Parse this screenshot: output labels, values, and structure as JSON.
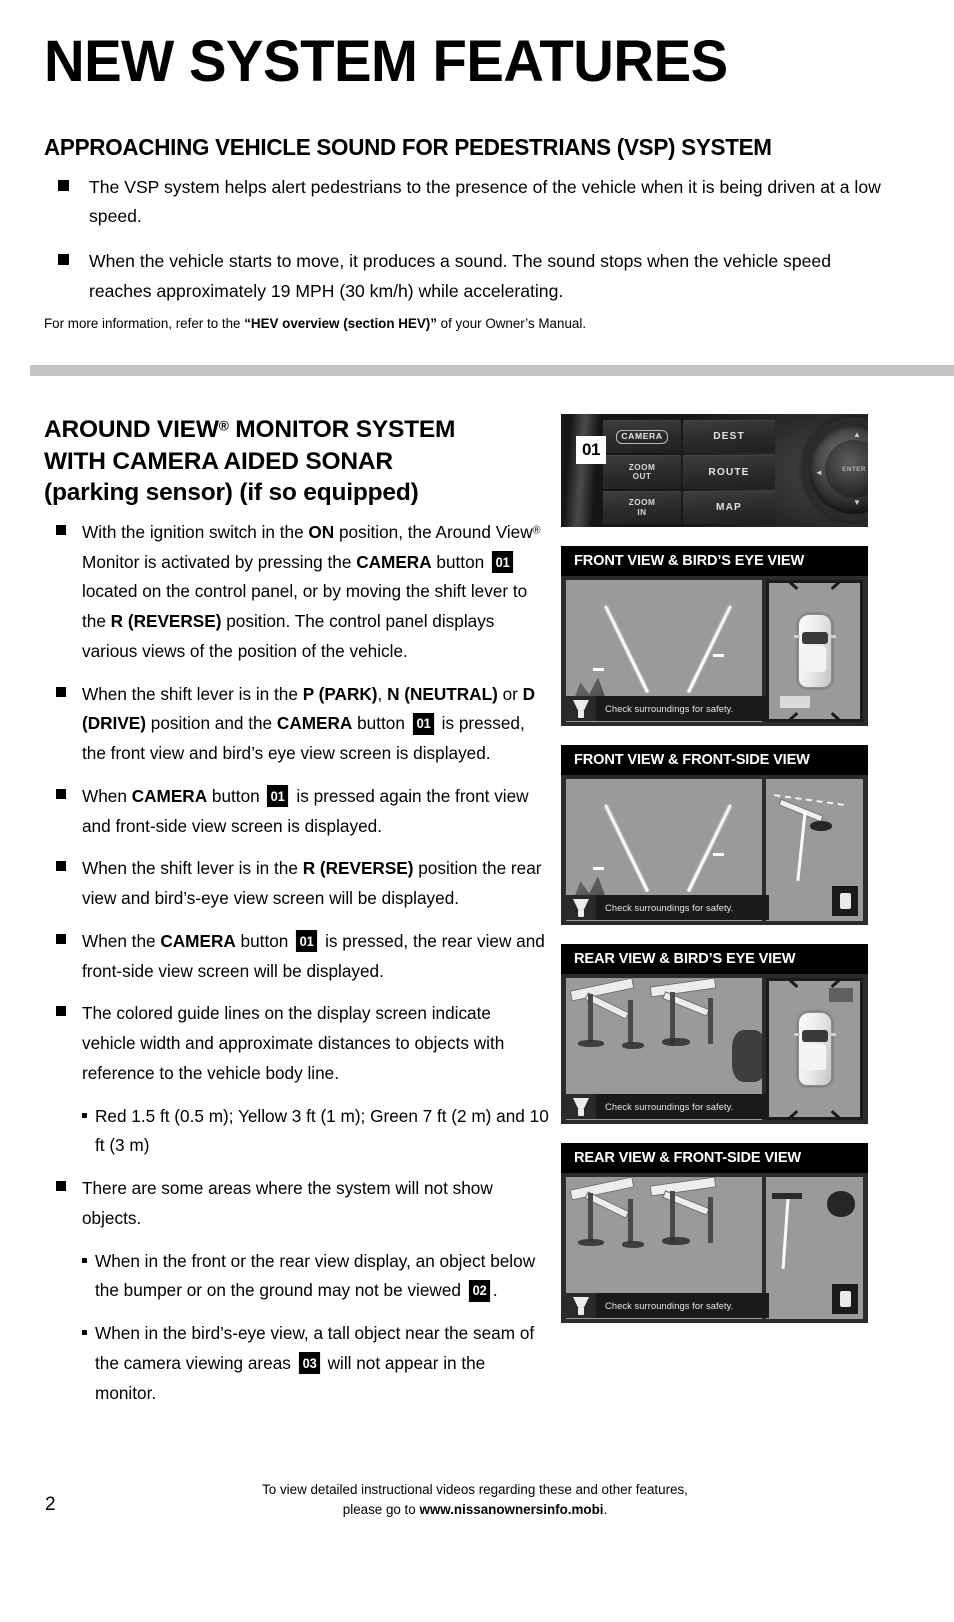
{
  "document": {
    "title": "NEW SYSTEM FEATURES",
    "page_number": "2"
  },
  "section_vsp": {
    "heading": "APPROACHING VEHICLE SOUND FOR PEDESTRIANS (VSP) SYSTEM",
    "bullets": [
      "The VSP system helps alert pedestrians to the presence of the vehicle when it is being driven at a low speed.",
      "When the vehicle starts to move, it produces a sound. The sound stops when the vehicle speed reaches approximately 19 MPH (30 km/h) while accelerating."
    ],
    "footnote_prefix": "For more information, refer to the ",
    "footnote_bold": "“HEV overview (section HEV)”",
    "footnote_suffix": " of your Owner’s Manual."
  },
  "section_avm": {
    "heading_line1": "AROUND VIEW",
    "heading_registered": "®",
    "heading_line1b": " MONITOR SYSTEM",
    "heading_line2": "WITH CAMERA AIDED SONAR",
    "heading_line3": "(parking sensor) (if so equipped)",
    "bullets": [
      {
        "id": "bullet-ignition-on",
        "parts": [
          {
            "t": "With the ignition switch in the "
          },
          {
            "t": "ON",
            "b": true
          },
          {
            "t": " position, the Around View"
          },
          {
            "t": "®",
            "sup": true
          },
          {
            "t": " Monitor is activated by pressing the "
          },
          {
            "t": "CAMERA",
            "b": true
          },
          {
            "t": " button "
          },
          {
            "t": "01",
            "callout": true
          },
          {
            "t": " located on the control panel, or by moving the shift lever to the "
          },
          {
            "t": "R (REVERSE)",
            "b": true
          },
          {
            "t": " position. The control panel displays various views of the position of the vehicle."
          }
        ]
      },
      {
        "id": "bullet-park-neutral-drive",
        "parts": [
          {
            "t": "When the shift lever is in the "
          },
          {
            "t": "P (PARK)",
            "b": true
          },
          {
            "t": ", "
          },
          {
            "t": "N (NEUTRAL)",
            "b": true
          },
          {
            "t": " or "
          },
          {
            "t": "D (DRIVE)",
            "b": true
          },
          {
            "t": " position and the "
          },
          {
            "t": "CAMERA",
            "b": true
          },
          {
            "t": " button "
          },
          {
            "t": "01",
            "callout": true
          },
          {
            "t": " is pressed, the front view and bird’s eye view screen is displayed."
          }
        ]
      },
      {
        "id": "bullet-camera-pressed-again",
        "parts": [
          {
            "t": "When "
          },
          {
            "t": "CAMERA",
            "b": true
          },
          {
            "t": " button "
          },
          {
            "t": "01",
            "callout": true
          },
          {
            "t": " is pressed again the front view and front-side view screen is displayed."
          }
        ]
      },
      {
        "id": "bullet-reverse-position",
        "parts": [
          {
            "t": "When the shift lever is in the "
          },
          {
            "t": "R (REVERSE)",
            "b": true
          },
          {
            "t": " position the rear view and bird’s-eye view screen will be displayed."
          }
        ]
      },
      {
        "id": "bullet-camera-rear-front-side",
        "parts": [
          {
            "t": "When the "
          },
          {
            "t": "CAMERA",
            "b": true
          },
          {
            "t": " button "
          },
          {
            "t": "01",
            "callout": true
          },
          {
            "t": " is pressed, the rear view and front-side view screen will be displayed."
          }
        ]
      },
      {
        "id": "bullet-guide-lines",
        "parts": [
          {
            "t": "The colored guide lines on the display screen indicate vehicle width and approximate distances to objects with reference to the vehicle body line."
          }
        ],
        "subs": [
          {
            "id": "sub-guide-line-colors",
            "parts": [
              {
                "t": "Red 1.5 ft (0.5 m); Yellow 3 ft (1 m); Green 7 ft (2 m) and 10 ft (3 m)"
              }
            ]
          }
        ]
      },
      {
        "id": "bullet-blind-areas",
        "parts": [
          {
            "t": "There are some areas where the system will not show objects."
          }
        ],
        "subs": [
          {
            "id": "sub-below-bumper",
            "parts": [
              {
                "t": "When in the front or the rear view display, an object below the bumper or on the ground may not be viewed "
              },
              {
                "t": "02",
                "callout": true
              },
              {
                "t": "."
              }
            ]
          },
          {
            "id": "sub-seam-tall-object",
            "parts": [
              {
                "t": "When in the bird’s-eye view, a tall object near the seam of the camera viewing areas "
              },
              {
                "t": "03",
                "callout": true
              },
              {
                "t": " will not appear in the monitor."
              }
            ]
          }
        ]
      }
    ]
  },
  "control_panel": {
    "callout": "01",
    "buttons": [
      "CAMERA",
      "DEST",
      "ZOOM OUT",
      "ROUTE",
      "ZOOM IN",
      "MAP"
    ],
    "camera_label": "CAMERA",
    "dest_label": "DEST",
    "zoom_out_label_line1": "ZOOM",
    "zoom_out_label_line2": "OUT",
    "route_label": "ROUTE",
    "zoom_in_label_line1": "ZOOM",
    "zoom_in_label_line2": "IN",
    "map_label": "MAP",
    "enter_label": "ENTER",
    "arrow_up": "▲",
    "arrow_down": "▼",
    "arrow_left": "◄",
    "arrow_right": "►"
  },
  "figures": [
    {
      "id": "figure-front-bird",
      "caption": "FRONT VIEW & BIRD’S EYE VIEW",
      "status_message": "Check surroundings for safety."
    },
    {
      "id": "figure-front-frontside",
      "caption": "FRONT VIEW & FRONT-SIDE VIEW",
      "status_message": "Check surroundings for safety."
    },
    {
      "id": "figure-rear-bird",
      "caption": "REAR VIEW & BIRD’S EYE VIEW",
      "status_message": "Check surroundings for safety."
    },
    {
      "id": "figure-rear-frontside",
      "caption": "REAR VIEW & FRONT-SIDE VIEW",
      "status_message": "Check surroundings for safety."
    }
  ],
  "footer": {
    "line1": "To view detailed instructional videos regarding these and other features,",
    "line2_prefix": "please go to ",
    "line2_bold": "www.nissanownersinfo.mobi",
    "line2_suffix": "."
  },
  "colors": {
    "divider": "#c3c6c8",
    "callout_bg": "#000000",
    "caption_bg": "#000000",
    "text": "#000000"
  }
}
